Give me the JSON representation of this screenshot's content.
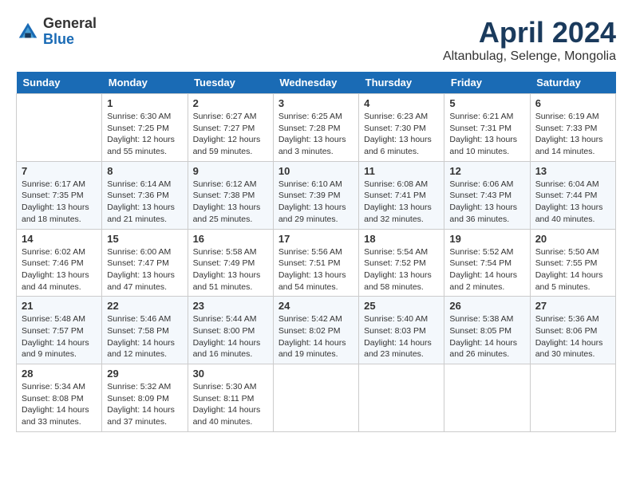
{
  "header": {
    "logo_general": "General",
    "logo_blue": "Blue",
    "month_title": "April 2024",
    "location": "Altanbulag, Selenge, Mongolia"
  },
  "columns": [
    "Sunday",
    "Monday",
    "Tuesday",
    "Wednesday",
    "Thursday",
    "Friday",
    "Saturday"
  ],
  "weeks": [
    {
      "days": [
        {
          "num": "",
          "sunrise": "",
          "sunset": "",
          "daylight": ""
        },
        {
          "num": "1",
          "sunrise": "Sunrise: 6:30 AM",
          "sunset": "Sunset: 7:25 PM",
          "daylight": "Daylight: 12 hours and 55 minutes."
        },
        {
          "num": "2",
          "sunrise": "Sunrise: 6:27 AM",
          "sunset": "Sunset: 7:27 PM",
          "daylight": "Daylight: 12 hours and 59 minutes."
        },
        {
          "num": "3",
          "sunrise": "Sunrise: 6:25 AM",
          "sunset": "Sunset: 7:28 PM",
          "daylight": "Daylight: 13 hours and 3 minutes."
        },
        {
          "num": "4",
          "sunrise": "Sunrise: 6:23 AM",
          "sunset": "Sunset: 7:30 PM",
          "daylight": "Daylight: 13 hours and 6 minutes."
        },
        {
          "num": "5",
          "sunrise": "Sunrise: 6:21 AM",
          "sunset": "Sunset: 7:31 PM",
          "daylight": "Daylight: 13 hours and 10 minutes."
        },
        {
          "num": "6",
          "sunrise": "Sunrise: 6:19 AM",
          "sunset": "Sunset: 7:33 PM",
          "daylight": "Daylight: 13 hours and 14 minutes."
        }
      ]
    },
    {
      "days": [
        {
          "num": "7",
          "sunrise": "Sunrise: 6:17 AM",
          "sunset": "Sunset: 7:35 PM",
          "daylight": "Daylight: 13 hours and 18 minutes."
        },
        {
          "num": "8",
          "sunrise": "Sunrise: 6:14 AM",
          "sunset": "Sunset: 7:36 PM",
          "daylight": "Daylight: 13 hours and 21 minutes."
        },
        {
          "num": "9",
          "sunrise": "Sunrise: 6:12 AM",
          "sunset": "Sunset: 7:38 PM",
          "daylight": "Daylight: 13 hours and 25 minutes."
        },
        {
          "num": "10",
          "sunrise": "Sunrise: 6:10 AM",
          "sunset": "Sunset: 7:39 PM",
          "daylight": "Daylight: 13 hours and 29 minutes."
        },
        {
          "num": "11",
          "sunrise": "Sunrise: 6:08 AM",
          "sunset": "Sunset: 7:41 PM",
          "daylight": "Daylight: 13 hours and 32 minutes."
        },
        {
          "num": "12",
          "sunrise": "Sunrise: 6:06 AM",
          "sunset": "Sunset: 7:43 PM",
          "daylight": "Daylight: 13 hours and 36 minutes."
        },
        {
          "num": "13",
          "sunrise": "Sunrise: 6:04 AM",
          "sunset": "Sunset: 7:44 PM",
          "daylight": "Daylight: 13 hours and 40 minutes."
        }
      ]
    },
    {
      "days": [
        {
          "num": "14",
          "sunrise": "Sunrise: 6:02 AM",
          "sunset": "Sunset: 7:46 PM",
          "daylight": "Daylight: 13 hours and 44 minutes."
        },
        {
          "num": "15",
          "sunrise": "Sunrise: 6:00 AM",
          "sunset": "Sunset: 7:47 PM",
          "daylight": "Daylight: 13 hours and 47 minutes."
        },
        {
          "num": "16",
          "sunrise": "Sunrise: 5:58 AM",
          "sunset": "Sunset: 7:49 PM",
          "daylight": "Daylight: 13 hours and 51 minutes."
        },
        {
          "num": "17",
          "sunrise": "Sunrise: 5:56 AM",
          "sunset": "Sunset: 7:51 PM",
          "daylight": "Daylight: 13 hours and 54 minutes."
        },
        {
          "num": "18",
          "sunrise": "Sunrise: 5:54 AM",
          "sunset": "Sunset: 7:52 PM",
          "daylight": "Daylight: 13 hours and 58 minutes."
        },
        {
          "num": "19",
          "sunrise": "Sunrise: 5:52 AM",
          "sunset": "Sunset: 7:54 PM",
          "daylight": "Daylight: 14 hours and 2 minutes."
        },
        {
          "num": "20",
          "sunrise": "Sunrise: 5:50 AM",
          "sunset": "Sunset: 7:55 PM",
          "daylight": "Daylight: 14 hours and 5 minutes."
        }
      ]
    },
    {
      "days": [
        {
          "num": "21",
          "sunrise": "Sunrise: 5:48 AM",
          "sunset": "Sunset: 7:57 PM",
          "daylight": "Daylight: 14 hours and 9 minutes."
        },
        {
          "num": "22",
          "sunrise": "Sunrise: 5:46 AM",
          "sunset": "Sunset: 7:58 PM",
          "daylight": "Daylight: 14 hours and 12 minutes."
        },
        {
          "num": "23",
          "sunrise": "Sunrise: 5:44 AM",
          "sunset": "Sunset: 8:00 PM",
          "daylight": "Daylight: 14 hours and 16 minutes."
        },
        {
          "num": "24",
          "sunrise": "Sunrise: 5:42 AM",
          "sunset": "Sunset: 8:02 PM",
          "daylight": "Daylight: 14 hours and 19 minutes."
        },
        {
          "num": "25",
          "sunrise": "Sunrise: 5:40 AM",
          "sunset": "Sunset: 8:03 PM",
          "daylight": "Daylight: 14 hours and 23 minutes."
        },
        {
          "num": "26",
          "sunrise": "Sunrise: 5:38 AM",
          "sunset": "Sunset: 8:05 PM",
          "daylight": "Daylight: 14 hours and 26 minutes."
        },
        {
          "num": "27",
          "sunrise": "Sunrise: 5:36 AM",
          "sunset": "Sunset: 8:06 PM",
          "daylight": "Daylight: 14 hours and 30 minutes."
        }
      ]
    },
    {
      "days": [
        {
          "num": "28",
          "sunrise": "Sunrise: 5:34 AM",
          "sunset": "Sunset: 8:08 PM",
          "daylight": "Daylight: 14 hours and 33 minutes."
        },
        {
          "num": "29",
          "sunrise": "Sunrise: 5:32 AM",
          "sunset": "Sunset: 8:09 PM",
          "daylight": "Daylight: 14 hours and 37 minutes."
        },
        {
          "num": "30",
          "sunrise": "Sunrise: 5:30 AM",
          "sunset": "Sunset: 8:11 PM",
          "daylight": "Daylight: 14 hours and 40 minutes."
        },
        {
          "num": "",
          "sunrise": "",
          "sunset": "",
          "daylight": ""
        },
        {
          "num": "",
          "sunrise": "",
          "sunset": "",
          "daylight": ""
        },
        {
          "num": "",
          "sunrise": "",
          "sunset": "",
          "daylight": ""
        },
        {
          "num": "",
          "sunrise": "",
          "sunset": "",
          "daylight": ""
        }
      ]
    }
  ]
}
